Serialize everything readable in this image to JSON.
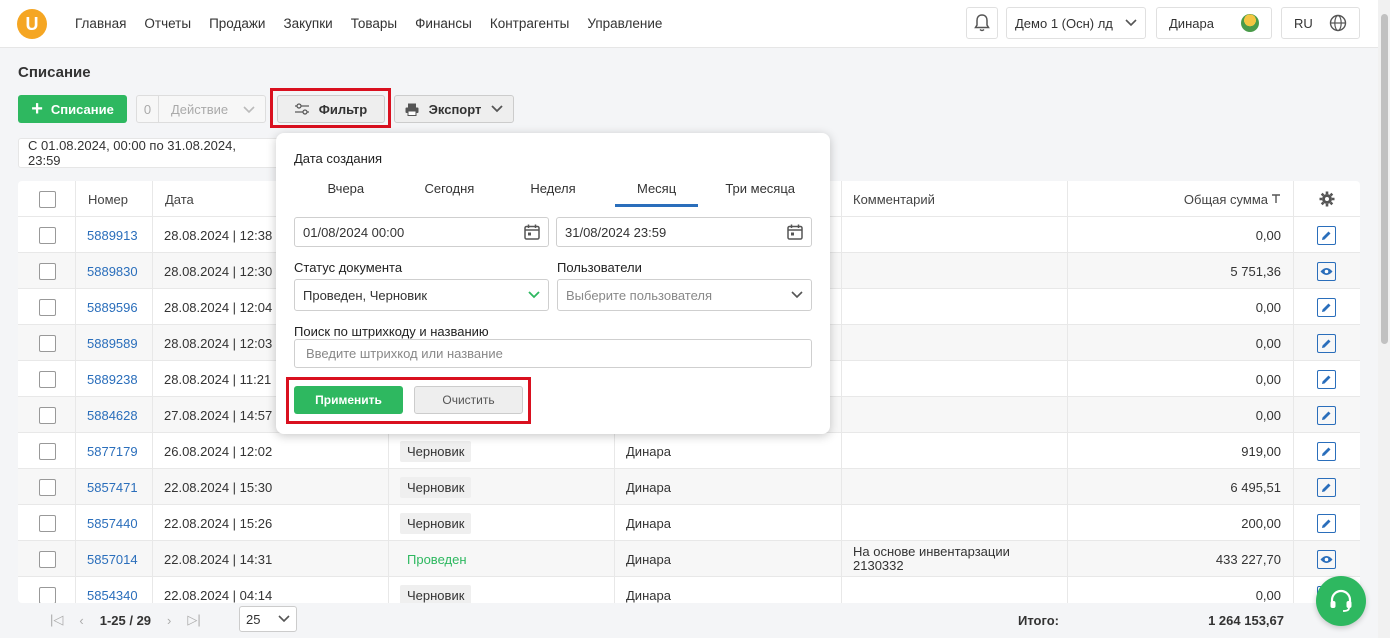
{
  "nav": {
    "logo": "U",
    "items": [
      "Главная",
      "Отчеты",
      "Продажи",
      "Закупки",
      "Товары",
      "Финансы",
      "Контрагенты",
      "Управление"
    ],
    "company": "Демо 1 (Осн) лд",
    "user": "Динара",
    "lang": "RU"
  },
  "page": {
    "title": "Списание",
    "add_label": "Списание",
    "action_count": "0",
    "action_label": "Действие",
    "filter_label": "Фильтр",
    "export_label": "Экспорт",
    "daterange": "С 01.08.2024, 00:00 по 31.08.2024, 23:59"
  },
  "table": {
    "headers": {
      "number": "Номер",
      "date": "Дата",
      "comment": "Комментарий",
      "total": "Общая сумма"
    },
    "rows": [
      {
        "number": "5889913",
        "date": "28.08.2024 | 12:38",
        "status": "",
        "user": "",
        "comment": "",
        "amount": "0,00",
        "action": "edit"
      },
      {
        "number": "5889830",
        "date": "28.08.2024 | 12:30",
        "status": "",
        "user": "",
        "comment": "",
        "amount": "5 751,36",
        "action": "view"
      },
      {
        "number": "5889596",
        "date": "28.08.2024 | 12:04",
        "status": "",
        "user": "",
        "comment": "",
        "amount": "0,00",
        "action": "edit"
      },
      {
        "number": "5889589",
        "date": "28.08.2024 | 12:03",
        "status": "",
        "user": "",
        "comment": "",
        "amount": "0,00",
        "action": "edit"
      },
      {
        "number": "5889238",
        "date": "28.08.2024 | 11:21",
        "status": "",
        "user": "",
        "comment": "",
        "amount": "0,00",
        "action": "edit"
      },
      {
        "number": "5884628",
        "date": "27.08.2024 | 14:57",
        "status": "",
        "user": "",
        "comment": "",
        "amount": "0,00",
        "action": "edit"
      },
      {
        "number": "5877179",
        "date": "26.08.2024 | 12:02",
        "status": "Черновик",
        "user": "Динара",
        "comment": "",
        "amount": "919,00",
        "action": "edit"
      },
      {
        "number": "5857471",
        "date": "22.08.2024 | 15:30",
        "status": "Черновик",
        "user": "Динара",
        "comment": "",
        "amount": "6 495,51",
        "action": "edit"
      },
      {
        "number": "5857440",
        "date": "22.08.2024 | 15:26",
        "status": "Черновик",
        "user": "Динара",
        "comment": "",
        "amount": "200,00",
        "action": "edit"
      },
      {
        "number": "5857014",
        "date": "22.08.2024 | 14:31",
        "status": "Проведен",
        "user": "Динара",
        "comment": "На основе инвентарзации 2130332",
        "amount": "433 227,70",
        "action": "view"
      },
      {
        "number": "5854340",
        "date": "22.08.2024 | 04:14",
        "status": "Черновик",
        "user": "Динара",
        "comment": "",
        "amount": "0,00",
        "action": "edit"
      }
    ]
  },
  "filter": {
    "date_label": "Дата создания",
    "tabs": [
      "Вчера",
      "Сегодня",
      "Неделя",
      "Месяц",
      "Три месяца"
    ],
    "active_tab": "Месяц",
    "date_from": "01/08/2024 00:00",
    "date_to": "31/08/2024 23:59",
    "status_label": "Статус документа",
    "status_value": "Проведен, Черновик",
    "users_label": "Пользователи",
    "users_placeholder": "Выберите пользователя",
    "search_label": "Поиск по штрихкоду и названию",
    "search_placeholder": "Введите штрихкод или название",
    "apply_label": "Применить",
    "clear_label": "Очистить"
  },
  "footer": {
    "range": "1-25 / 29",
    "page_size": "25",
    "total_label": "Итого:",
    "total_value": "1 264 153,67"
  },
  "colors": {
    "accent_green": "#2eb860",
    "link_blue": "#2a6ebb",
    "highlight_red": "#d9101f"
  }
}
